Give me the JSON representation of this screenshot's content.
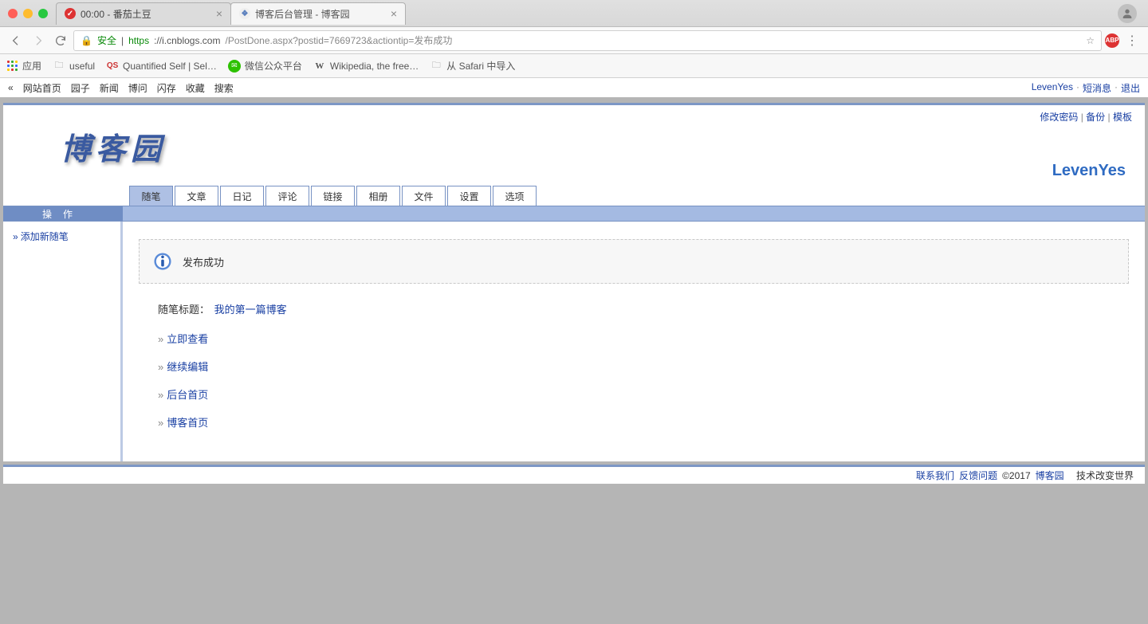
{
  "browser": {
    "tabs": [
      {
        "title": "00:00 - 番茄土豆",
        "icon_bg": "#d33",
        "icon_fg": "#fff",
        "icon_char": "✓"
      },
      {
        "title": "博客后台管理 - 博客园",
        "icon_bg": "#eee",
        "icon_fg": "#5a7fbd",
        "icon_char": "❖"
      }
    ],
    "url_secure_label": "安全",
    "url_scheme": "https",
    "url_host": "://i.cnblogs.com",
    "url_path": "/PostDone.aspx?postid=7669723&actiontip=发布成功",
    "abp_label": "ABP",
    "bookmarks": [
      {
        "label": "应用",
        "icon": "apps"
      },
      {
        "label": "useful",
        "icon": "folder"
      },
      {
        "label": "Quantified Self | Sel…",
        "icon": "qs"
      },
      {
        "label": "微信公众平台",
        "icon": "wechat"
      },
      {
        "label": "Wikipedia, the free…",
        "icon": "w"
      },
      {
        "label": "从 Safari 中导入",
        "icon": "folder"
      }
    ]
  },
  "topnav": {
    "left": [
      "网站首页",
      "园子",
      "新闻",
      "博问",
      "闪存",
      "收藏",
      "搜索"
    ],
    "chev": "«",
    "right_user": "LevenYes",
    "right_msgs": "短消息",
    "right_logout": "退出"
  },
  "admin": {
    "corner": {
      "pwd": "修改密码",
      "backup": "备份",
      "tmpl": "模板"
    },
    "logo": "博客园",
    "username": "LevenYes",
    "tabs": [
      "随笔",
      "文章",
      "日记",
      "评论",
      "链接",
      "相册",
      "文件",
      "设置",
      "选项"
    ],
    "active_tab": 0,
    "sidebar_header": "操作",
    "sidebar_link": "添加新随笔",
    "msg_text": "发布成功",
    "post_label": "随笔标题：",
    "post_title": "我的第一篇博客",
    "actions": [
      "立即查看",
      "继续编辑",
      "后台首页",
      "博客首页"
    ]
  },
  "footer": {
    "contact": "联系我们",
    "feedback": "反馈问题",
    "copy": "©2017",
    "site": "博客园",
    "tagline": "技术改变世界"
  }
}
